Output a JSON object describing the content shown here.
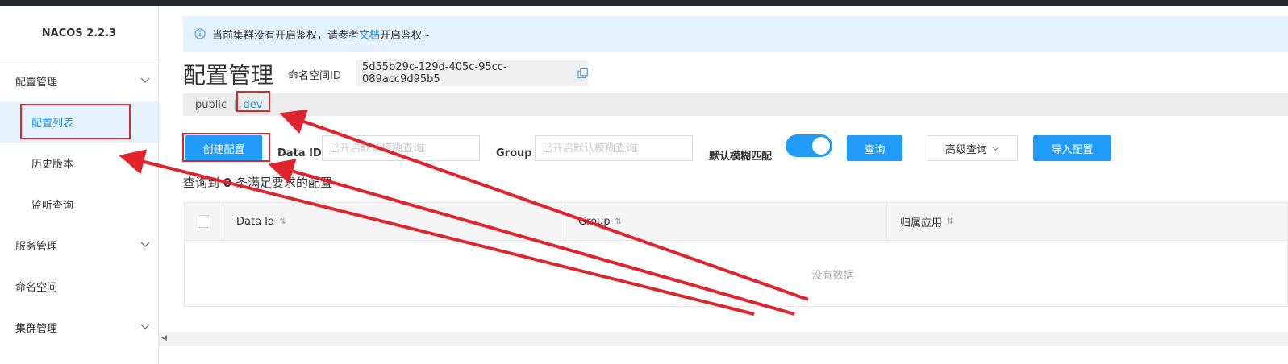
{
  "sidebar": {
    "logo": "NACOS 2.2.3",
    "items": [
      {
        "label": "配置管理"
      },
      {
        "label": "配置列表"
      },
      {
        "label": "历史版本"
      },
      {
        "label": "监听查询"
      },
      {
        "label": "服务管理"
      },
      {
        "label": "命名空间"
      },
      {
        "label": "集群管理"
      }
    ]
  },
  "notice": {
    "text_before": "当前集群没有开启鉴权，请参考",
    "link": "文档",
    "text_after": "开启鉴权~"
  },
  "header": {
    "title": "配置管理",
    "namespace_label": "命名空间ID",
    "namespace_id": "5d55b29c-129d-405c-95cc-089acc9d95b5"
  },
  "namespaces": {
    "tabs": [
      "public",
      "dev"
    ],
    "selected": "dev",
    "separator": "|"
  },
  "toolbar": {
    "create_label": "创建配置",
    "dataid_label": "Data ID",
    "dataid_placeholder": "已开启默认模糊查询",
    "group_label": "Group",
    "group_placeholder": "已开启默认模糊查询",
    "fuzzy_label": "默认模糊匹配",
    "fuzzy_on": true,
    "query_label": "查询",
    "advanced_label": "高级查询",
    "import_label": "导入配置"
  },
  "result": {
    "prefix": "查询到",
    "count": "0",
    "suffix": "条满足要求的配置"
  },
  "table": {
    "columns": [
      "Data Id",
      "Group",
      "归属应用"
    ],
    "empty_text": "没有数据"
  },
  "colors": {
    "primary": "#209bfa",
    "annotation": "#e0242d",
    "topbar": "#252a2f"
  }
}
